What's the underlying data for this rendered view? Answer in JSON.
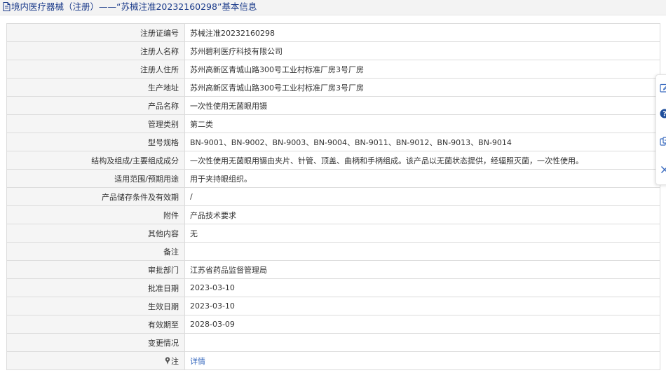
{
  "header": {
    "title": "境内医疗器械（注册）——“苏械注准20232160298”基本信息"
  },
  "rows": [
    {
      "label": "注册证编号",
      "value": "苏械注准20232160298"
    },
    {
      "label": "注册人名称",
      "value": "苏州碧利医疗科技有限公司"
    },
    {
      "label": "注册人住所",
      "value": "苏州高新区青城山路300号工业村标准厂房3号厂房"
    },
    {
      "label": "生产地址",
      "value": "苏州高新区青城山路300号工业村标准厂房3号厂房"
    },
    {
      "label": "产品名称",
      "value": "一次性使用无菌眼用镊"
    },
    {
      "label": "管理类别",
      "value": "第二类"
    },
    {
      "label": "型号规格",
      "value": "BN-9001、BN-9002、BN-9003、BN-9004、BN-9011、BN-9012、BN-9013、BN-9014"
    },
    {
      "label": "结构及组成/主要组成成分",
      "value": "一次性使用无菌眼用镊由夹片、针管、顶盖、曲柄和手柄组成。该产品以无菌状态提供，经辐照灭菌，一次性使用。"
    },
    {
      "label": "适用范围/预期用途",
      "value": "用于夹持眼组织。"
    },
    {
      "label": "产品储存条件及有效期",
      "value": "/"
    },
    {
      "label": "附件",
      "value": "产品技术要求"
    },
    {
      "label": "其他内容",
      "value": "无"
    },
    {
      "label": "备注",
      "value": ""
    },
    {
      "label": "审批部门",
      "value": "江苏省药品监督管理局"
    },
    {
      "label": "批准日期",
      "value": "2023-03-10"
    },
    {
      "label": "生效日期",
      "value": "2023-03-10"
    },
    {
      "label": "有效期至",
      "value": "2028-03-09"
    },
    {
      "label": "变更情况",
      "value": ""
    }
  ],
  "note": {
    "label": "注",
    "link": "详情"
  },
  "icons": {
    "title": "document-icon",
    "note": "pin-icon",
    "sidebar": [
      "edit-icon",
      "help-icon",
      "share-icon",
      "close-icon"
    ]
  },
  "colors": {
    "title": "#1a3a8a",
    "link": "#3a6bbf",
    "label_bg": "#f5f5f5",
    "border": "#dcdcdc"
  }
}
